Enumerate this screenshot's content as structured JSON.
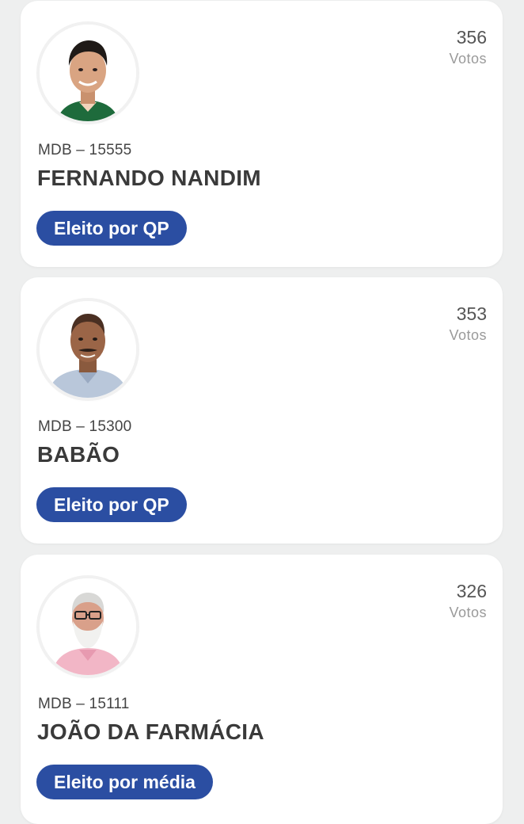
{
  "candidates": [
    {
      "votes": "356",
      "votes_label": "Votos",
      "party_number": "MDB – 15555",
      "name": "FERNANDO NANDIM",
      "status": "Eleito por QP",
      "avatar_icon": "person-photo"
    },
    {
      "votes": "353",
      "votes_label": "Votos",
      "party_number": "MDB – 15300",
      "name": "BABÃO",
      "status": "Eleito por QP",
      "avatar_icon": "person-photo"
    },
    {
      "votes": "326",
      "votes_label": "Votos",
      "party_number": "MDB – 15111",
      "name": "JOÃO DA FARMÁCIA",
      "status": "Eleito por média",
      "avatar_icon": "person-photo"
    }
  ],
  "colors": {
    "badge_bg": "#2b4ea2",
    "page_bg": "#eeefef",
    "card_bg": "#ffffff"
  }
}
